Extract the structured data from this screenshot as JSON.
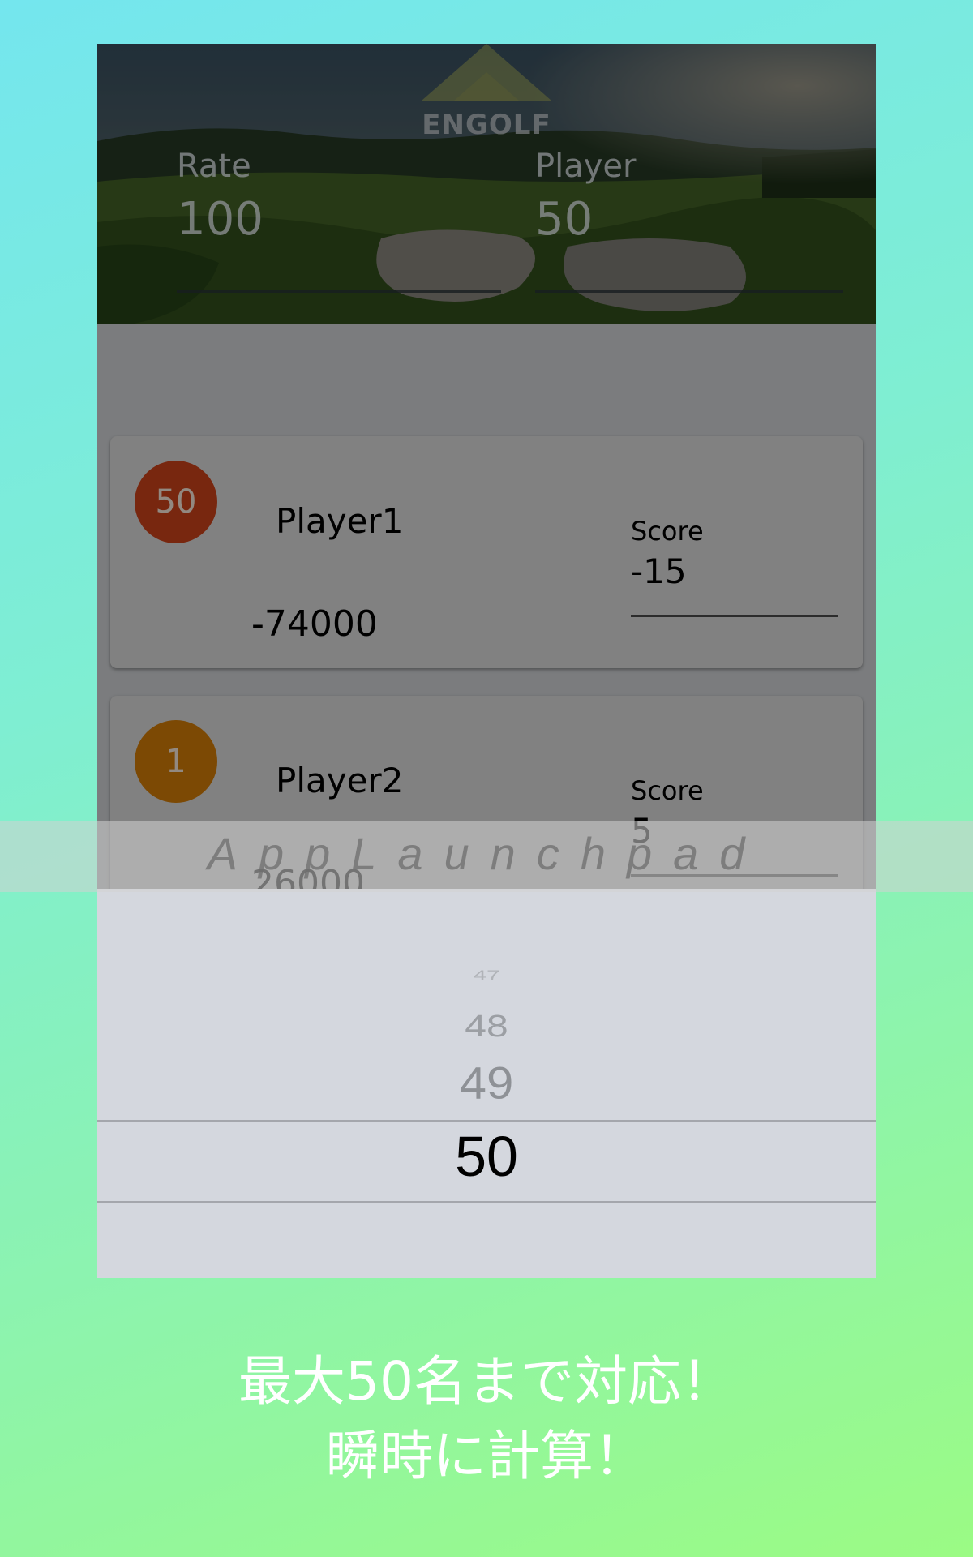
{
  "header": {
    "logo_text": "ENGOLF",
    "rate_label": "Rate",
    "rate_value": "100",
    "player_label": "Player",
    "player_value": "50"
  },
  "players": [
    {
      "rank": "50",
      "name": "Player1",
      "amount": "-74000",
      "score_label": "Score",
      "score": "-15",
      "badge_color": "#c8421a"
    },
    {
      "rank": "1",
      "name": "Player2",
      "amount": "26000",
      "score_label": "Score",
      "score": "5",
      "badge_color": "#cf7a08"
    }
  ],
  "picker": {
    "options": [
      "47",
      "48",
      "49",
      "50"
    ],
    "selected": "50"
  },
  "watermark": "AppLaunchpad",
  "caption": {
    "line1": "最大50名まで対応！",
    "line2": "瞬時に計算！"
  }
}
